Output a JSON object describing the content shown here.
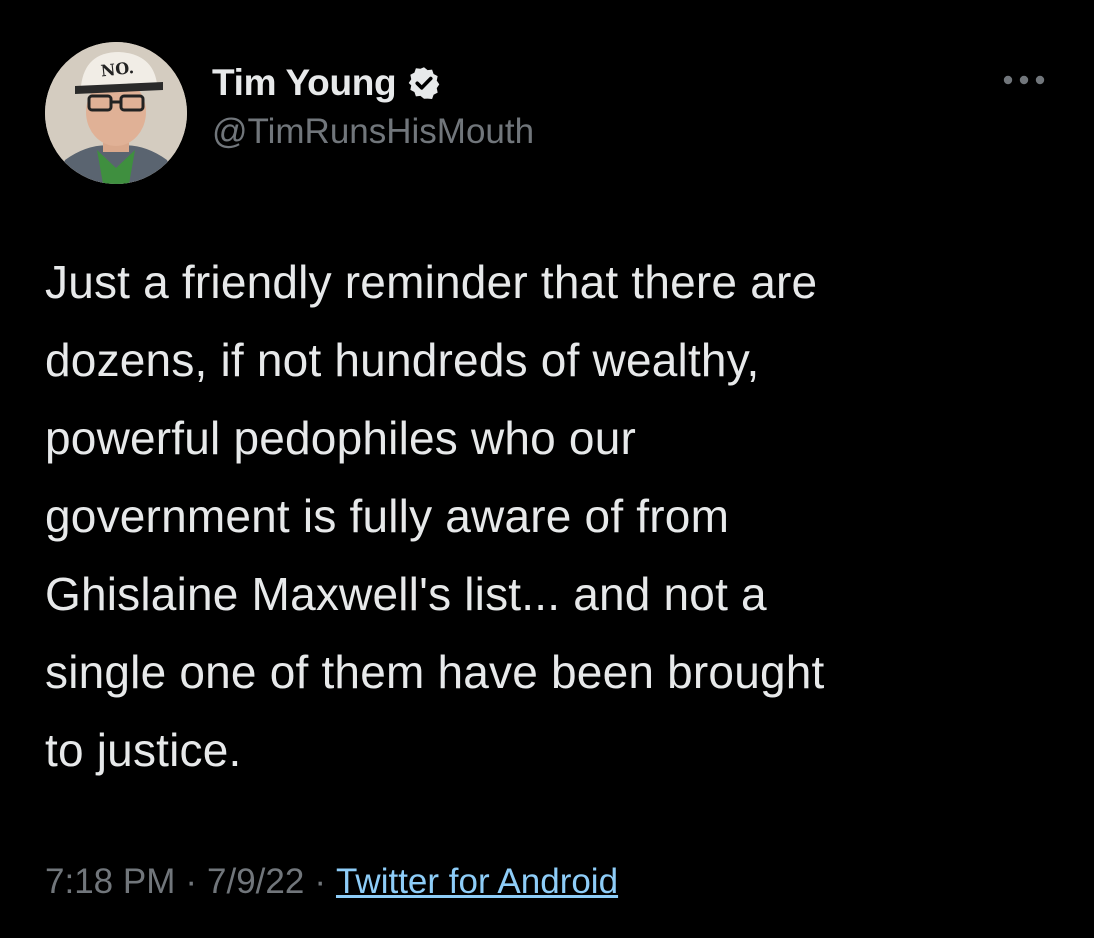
{
  "author": {
    "display_name": "Tim Young",
    "handle": "@TimRunsHisMouth",
    "verified": true,
    "avatar_cap_text": "NO."
  },
  "tweet": {
    "text": "Just a friendly reminder that there are\ndozens, if not hundreds of wealthy,\npowerful pedophiles who our\ngovernment is fully aware of from\nGhislaine Maxwell's list...  and not a\nsingle one of them have been brought\nto justice."
  },
  "meta": {
    "time": "7:18 PM",
    "separator": "·",
    "date": "7/9/22",
    "source": "Twitter for Android"
  },
  "icons": {
    "verified": "verified-badge-icon",
    "more": "more-horizontal-icon"
  },
  "colors": {
    "background": "#000000",
    "primary_text": "#e7e9ea",
    "secondary_text": "#71767b",
    "link": "#8ecdf8"
  }
}
